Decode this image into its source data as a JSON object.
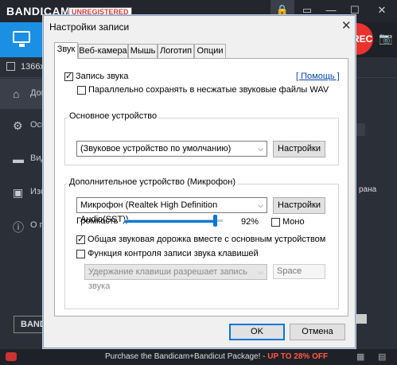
{
  "app": {
    "logo": "BANDICAM",
    "unregistered": "UNREGISTERED",
    "rec_label": "REC",
    "resolution": "1366x7",
    "sidebar": [
      {
        "label": "Дом",
        "icon": "home-icon",
        "glyph": "⌂"
      },
      {
        "label": "Осн",
        "icon": "gear-icon",
        "glyph": "⚙"
      },
      {
        "label": "Вид",
        "icon": "video-icon",
        "glyph": "▬"
      },
      {
        "label": "Изо",
        "icon": "image-icon",
        "glyph": "▣"
      },
      {
        "label": "О пр",
        "icon": "info-icon",
        "glyph": "ⓘ"
      }
    ],
    "sidebar_button": "BANDI",
    "right_text": "рана",
    "bottom_text": "Purchase the Bandicam+Bandicut Package! - ",
    "bottom_highlight": "UP TO 28% OFF"
  },
  "dialog": {
    "title": "Настройки записи",
    "tabs": [
      {
        "label": "Звук",
        "active": true
      },
      {
        "label": "Веб-камера",
        "active": false
      },
      {
        "label": "Мышь",
        "active": false
      },
      {
        "label": "Логотип",
        "active": false
      },
      {
        "label": "Опции",
        "active": false
      }
    ],
    "record_sound": {
      "label": "Запись звука",
      "checked": true
    },
    "help_link": "[ Помощь ]",
    "parallel_wav": {
      "label": "Параллельно сохранять в несжатые звуковые файлы WAV",
      "checked": false
    },
    "primary_device": {
      "caption": "Основное устройство",
      "value": "(Звуковое устройство по умолчанию)",
      "settings_label": "Настройки"
    },
    "secondary_device": {
      "caption": "Дополнительное устройство (Микрофон)",
      "value": "Микрофон (Realtek High Definition Audio(SST))",
      "settings_label": "Настройки",
      "volume_label": "Громкость",
      "volume_value": 0.92,
      "volume_text": "92%",
      "mono": {
        "label": "Моно",
        "checked": false
      },
      "mix": {
        "label": "Общая звуковая дорожка вместе с основным устройством",
        "checked": true
      },
      "hotkey": {
        "label": "Функция контроля записи звука клавишей",
        "checked": false
      },
      "hotkey_mode": "Удержание клавиши разрешает запись звука",
      "hotkey_key": "Space"
    },
    "ok_label": "OK",
    "cancel_label": "Отмена"
  }
}
